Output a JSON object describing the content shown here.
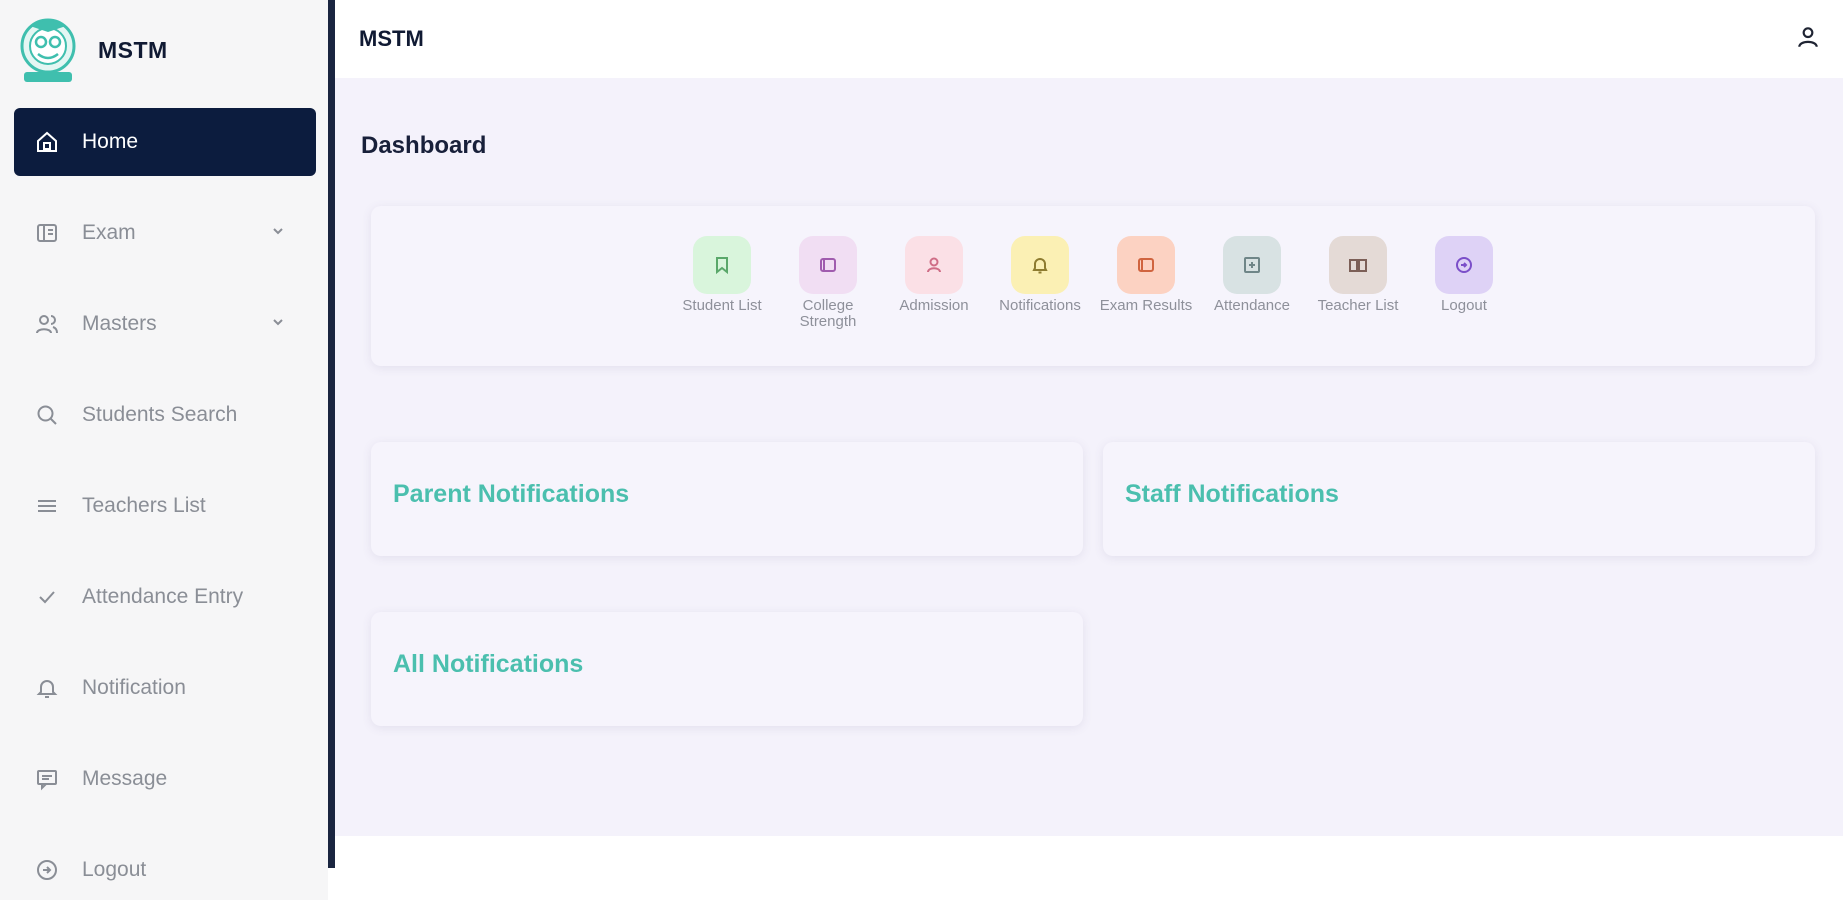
{
  "brand": {
    "name": "MSTM"
  },
  "header": {
    "title": "MSTM"
  },
  "sidebar": {
    "items": [
      {
        "label": "Home",
        "icon": "home-icon",
        "active": true,
        "has_submenu": false
      },
      {
        "label": "Exam",
        "icon": "exam-icon",
        "active": false,
        "has_submenu": true
      },
      {
        "label": "Masters",
        "icon": "users-icon",
        "active": false,
        "has_submenu": true
      },
      {
        "label": "Students Search",
        "icon": "search-icon",
        "active": false,
        "has_submenu": false
      },
      {
        "label": "Teachers List",
        "icon": "list-icon",
        "active": false,
        "has_submenu": false
      },
      {
        "label": "Attendance Entry",
        "icon": "check-icon",
        "active": false,
        "has_submenu": false
      },
      {
        "label": "Notification",
        "icon": "bell-icon",
        "active": false,
        "has_submenu": false
      },
      {
        "label": "Message",
        "icon": "message-icon",
        "active": false,
        "has_submenu": false
      },
      {
        "label": "Logout",
        "icon": "logout-icon",
        "active": false,
        "has_submenu": false
      }
    ]
  },
  "main": {
    "title": "Dashboard",
    "quick_links": [
      {
        "label": "Student List",
        "icon": "bookmark-icon",
        "bg": "#d9f5dc",
        "fg": "#5aa86a"
      },
      {
        "label": "College Strength",
        "icon": "book-icon",
        "bg": "#f1def3",
        "fg": "#a05cae"
      },
      {
        "label": "Admission",
        "icon": "user-icon",
        "bg": "#fbe0e6",
        "fg": "#cf6d86"
      },
      {
        "label": "Notifications",
        "icon": "bell-icon",
        "bg": "#fbf0b4",
        "fg": "#8e7c30"
      },
      {
        "label": "Exam Results",
        "icon": "book-icon",
        "bg": "#fcd2c2",
        "fg": "#d0643f"
      },
      {
        "label": "Attendance",
        "icon": "calendar-icon",
        "bg": "#d8e2e3",
        "fg": "#6f8688"
      },
      {
        "label": "Teacher List",
        "icon": "open-book-icon",
        "bg": "#e4dad6",
        "fg": "#7c5f57"
      },
      {
        "label": "Logout",
        "icon": "logout-icon",
        "bg": "#ded2f6",
        "fg": "#7b4fc9"
      }
    ],
    "cards": {
      "parent": "Parent Notifications",
      "staff": "Staff Notifications",
      "all": "All Notifications"
    }
  },
  "colors": {
    "sidebar_active": "#0c1c3e",
    "accent_teal": "#4bbfae",
    "main_bg": "#f4f2fb"
  }
}
